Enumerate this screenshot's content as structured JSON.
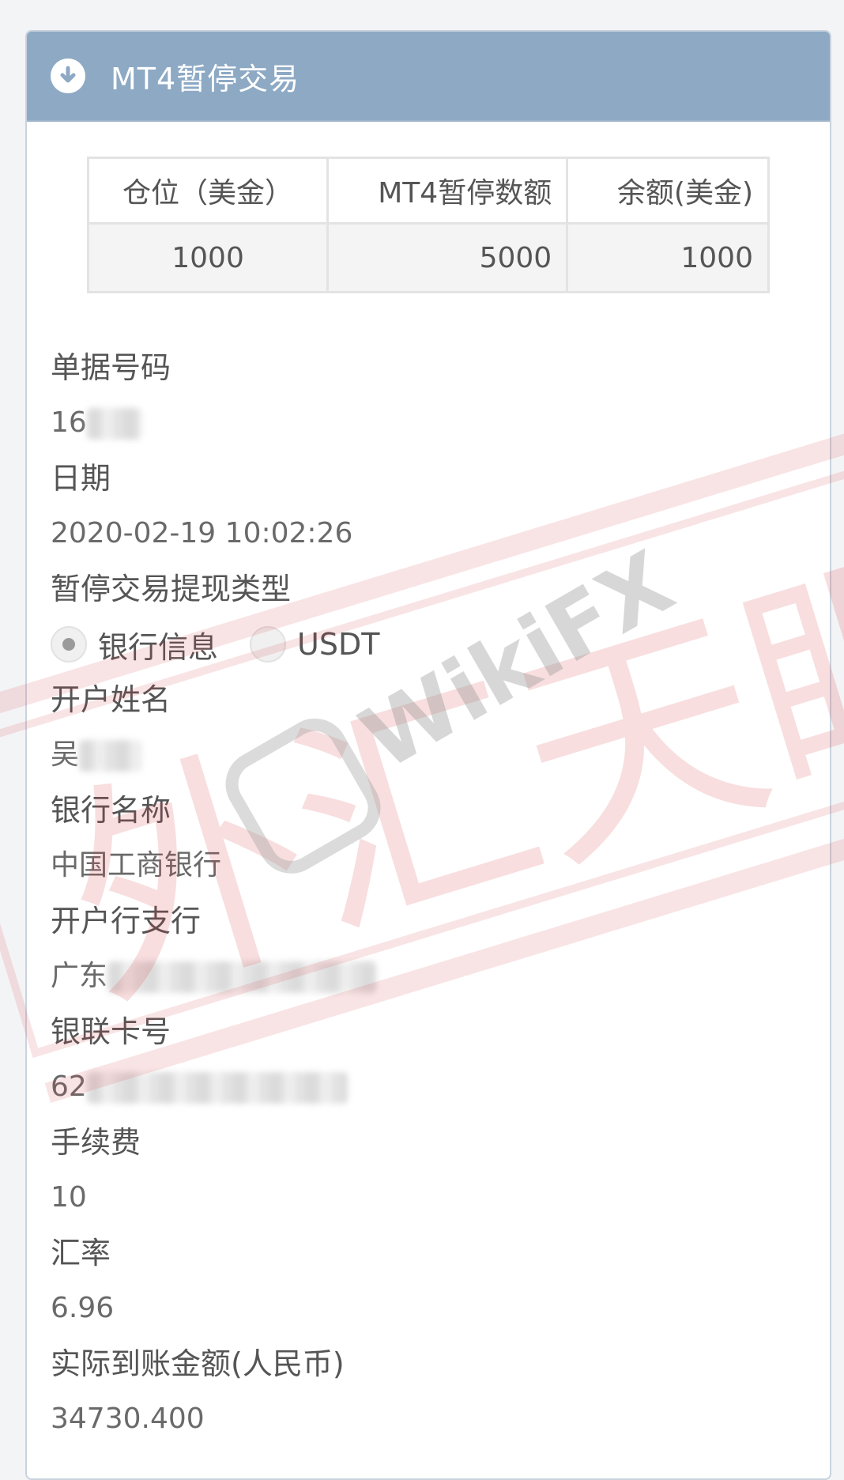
{
  "header": {
    "title": "MT4暂停交易",
    "icon": "arrow-down-circle-icon"
  },
  "summary": {
    "headers": [
      "仓位（美金）",
      "MT4暂停数额",
      "余额(美金)"
    ],
    "values": [
      "1000",
      "5000",
      "1000"
    ]
  },
  "fields": {
    "receipt_no": {
      "label": "单据号码",
      "value": "16"
    },
    "date": {
      "label": "日期",
      "value": "2020-02-19 10:02:26"
    },
    "withdraw_type": {
      "label": "暂停交易提现类型",
      "options": [
        "银行信息",
        "USDT"
      ],
      "selected": "银行信息"
    },
    "account_name": {
      "label": "开户姓名",
      "value": "吴"
    },
    "bank_name": {
      "label": "银行名称",
      "value": "中国工商银行"
    },
    "branch": {
      "label": "开户行支行",
      "value": "广东"
    },
    "card_no": {
      "label": "银联卡号",
      "value": "62"
    },
    "fee": {
      "label": "手续费",
      "value": "10"
    },
    "rate": {
      "label": "汇率",
      "value": "6.96"
    },
    "actual_amount": {
      "label": "实际到账金额(人民币)",
      "value": "34730.400"
    }
  },
  "watermark": {
    "text": "WikiFX",
    "stamp": "外汇天眼",
    "color": "#d9363e"
  }
}
